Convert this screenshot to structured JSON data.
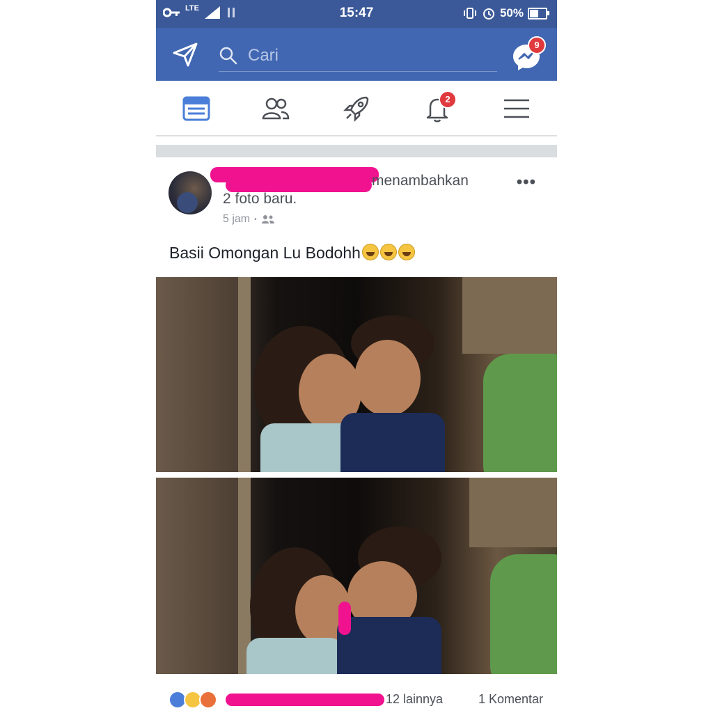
{
  "status_bar": {
    "time": "15:47",
    "network": "LTE",
    "battery": "50%",
    "battery_level": 0.5
  },
  "top_bar": {
    "search_placeholder": "Cari",
    "messenger_badge": "9"
  },
  "nav": {
    "notifications_badge": "2",
    "items": [
      "news-feed",
      "friends",
      "discover",
      "notifications",
      "menu"
    ]
  },
  "post": {
    "action_text": "menambahkan",
    "action_text_2": "2 foto baru.",
    "time": "5 jam",
    "audience": "friends",
    "caption": "Basii Omongan Lu Bodohh",
    "caption_emoji_count": 3,
    "reactions_others": "12 lainnya",
    "comments": "1 Komentar"
  },
  "colors": {
    "brand": "#4267b2",
    "status_bar": "#3b5998",
    "badge": "#e0393e",
    "redaction": "#f0128e"
  }
}
